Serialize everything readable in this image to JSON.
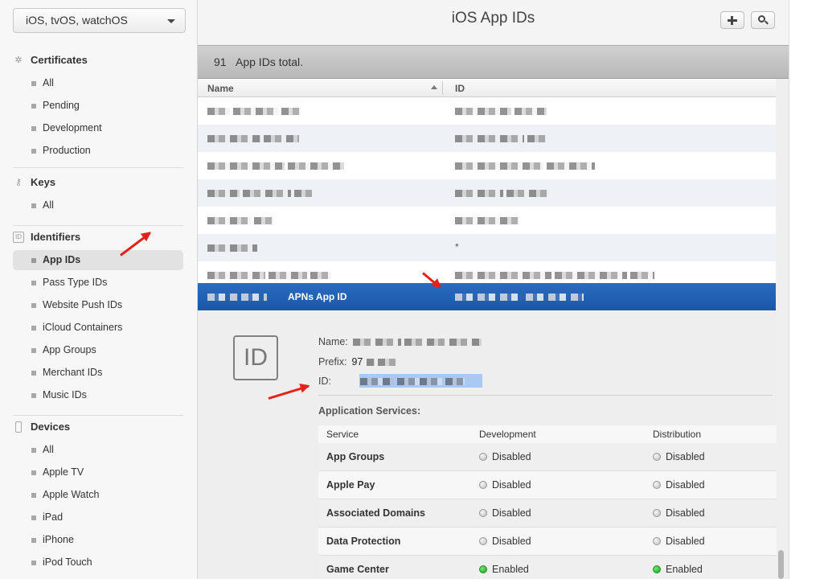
{
  "sidebar": {
    "platform_select": "iOS, tvOS, watchOS",
    "sections": [
      {
        "title": "Certificates",
        "icon": "certificate-icon",
        "items": [
          "All",
          "Pending",
          "Development",
          "Production"
        ]
      },
      {
        "title": "Keys",
        "icon": "key-icon",
        "items": [
          "All"
        ]
      },
      {
        "title": "Identifiers",
        "icon": "id-icon",
        "icon_text": "ID",
        "items": [
          "App IDs",
          "Pass Type IDs",
          "Website Push IDs",
          "iCloud Containers",
          "App Groups",
          "Merchant IDs",
          "Music IDs"
        ]
      },
      {
        "title": "Devices",
        "icon": "device-icon",
        "items": [
          "All",
          "Apple TV",
          "Apple Watch",
          "iPad",
          "iPhone",
          "iPod Touch"
        ]
      }
    ],
    "active_item": "App IDs"
  },
  "header": {
    "title": "iOS App IDs",
    "add_icon": "plus-icon",
    "search_icon": "search-icon"
  },
  "summary": {
    "count": "91",
    "text": "App IDs total."
  },
  "table": {
    "columns": [
      "Name",
      "ID"
    ],
    "rows": [
      {
        "id_text": ""
      },
      {
        "id_text": ""
      },
      {
        "id_text": ""
      },
      {
        "id_text": ""
      },
      {
        "id_text": ""
      },
      {
        "id_text": "*"
      },
      {
        "id_text": ""
      },
      {
        "name_suffix": "APNs App ID",
        "selected": true
      }
    ]
  },
  "detail": {
    "badge": "ID",
    "name_label": "Name:",
    "prefix_label": "Prefix:",
    "prefix_value": "97",
    "id_label": "ID:",
    "services_title": "Application Services:",
    "services_columns": [
      "Service",
      "Development",
      "Distribution"
    ],
    "services": [
      {
        "name": "App Groups",
        "development": "Disabled",
        "distribution": "Disabled"
      },
      {
        "name": "Apple Pay",
        "development": "Disabled",
        "distribution": "Disabled"
      },
      {
        "name": "Associated Domains",
        "development": "Disabled",
        "distribution": "Disabled"
      },
      {
        "name": "Data Protection",
        "development": "Disabled",
        "distribution": "Disabled"
      },
      {
        "name": "Game Center",
        "development": "Enabled",
        "distribution": "Enabled"
      }
    ]
  },
  "colors": {
    "selected_row": "#1f5fb3",
    "annotation_arrow": "#e32219",
    "enabled": "#17a317"
  }
}
